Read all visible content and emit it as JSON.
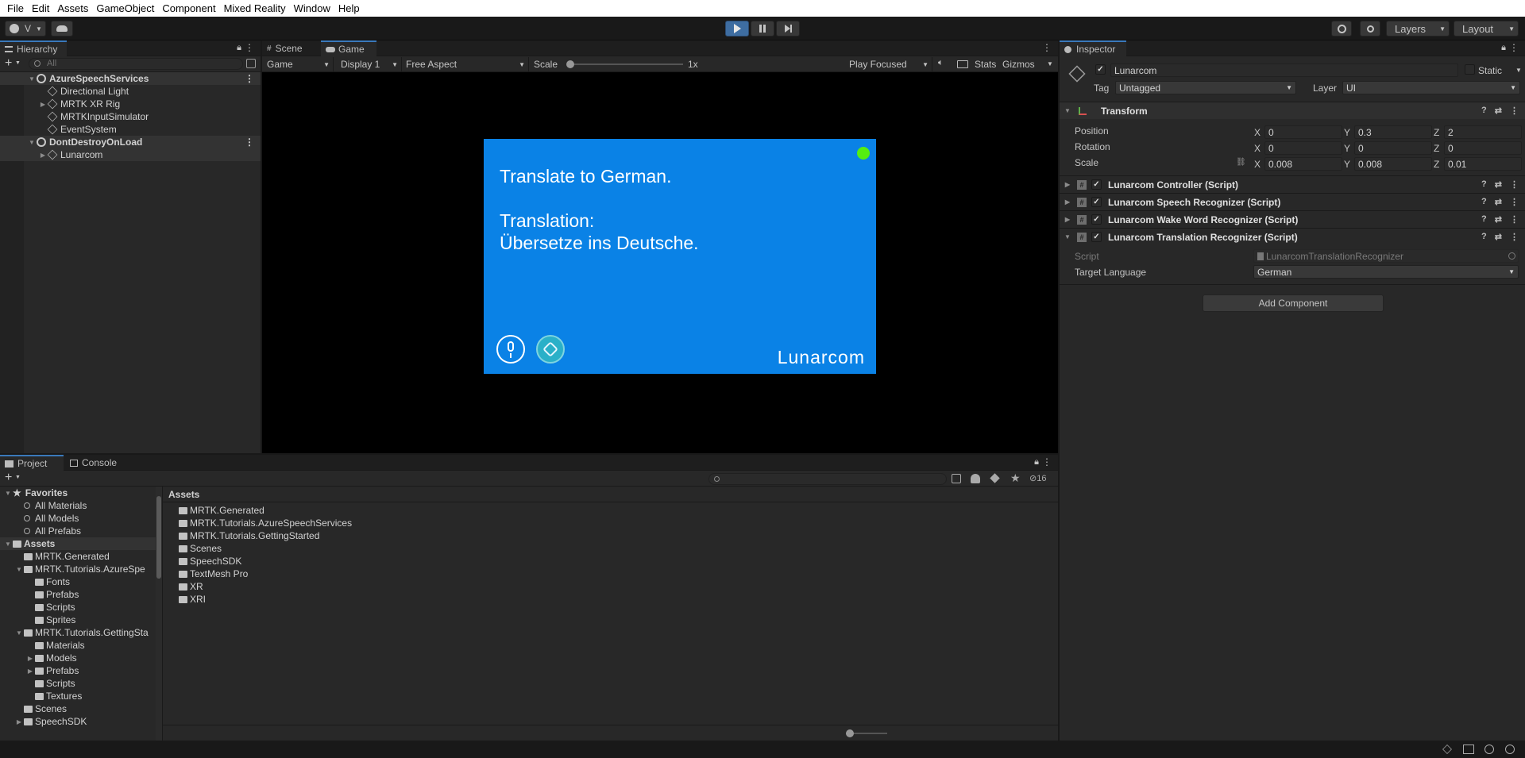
{
  "menu": [
    "File",
    "Edit",
    "Assets",
    "GameObject",
    "Component",
    "Mixed Reality",
    "Window",
    "Help"
  ],
  "toolbar": {
    "account_label": "V",
    "layers_label": "Layers",
    "layout_label": "Layout"
  },
  "hierarchy": {
    "tab": "Hierarchy",
    "search_placeholder": "All",
    "items": [
      {
        "label": "AzureSpeechServices",
        "scene": true
      },
      {
        "label": "Directional Light"
      },
      {
        "label": "MRTK XR Rig"
      },
      {
        "label": "MRTKInputSimulator"
      },
      {
        "label": "EventSystem"
      },
      {
        "label": "DontDestroyOnLoad",
        "scene": true
      },
      {
        "label": "Lunarcom"
      }
    ]
  },
  "game_view": {
    "tabs": [
      "Scene",
      "Game"
    ],
    "game_dropdown": "Game",
    "display": "Display 1",
    "aspect": "Free Aspect",
    "scale_label": "Scale",
    "scale_value": "1x",
    "play_focused": "Play Focused",
    "stats": "Stats",
    "gizmos": "Gizmos",
    "card": {
      "line1": "Translate to German.",
      "line2": "Translation:",
      "line3": "Übersetze ins Deutsche.",
      "brand": "Lunarcom",
      "bg_color": "#0a82e6",
      "status_color": "#55ee11"
    }
  },
  "inspector": {
    "tab": "Inspector",
    "object_name": "Lunarcom",
    "static_label": "Static",
    "tag_label": "Tag",
    "tag_value": "Untagged",
    "layer_label": "Layer",
    "layer_value": "UI",
    "transform": {
      "title": "Transform",
      "position_label": "Position",
      "rotation_label": "Rotation",
      "scale_label": "Scale",
      "position": {
        "x": "0",
        "y": "0.3",
        "z": "2"
      },
      "rotation": {
        "x": "0",
        "y": "0",
        "z": "0"
      },
      "scale": {
        "x": "0.008",
        "y": "0.008",
        "z": "0.01"
      }
    },
    "components": [
      "Lunarcom Controller (Script)",
      "Lunarcom Speech Recognizer (Script)",
      "Lunarcom Wake Word Recognizer (Script)",
      "Lunarcom Translation Recognizer (Script)"
    ],
    "script_label": "Script",
    "script_value": "LunarcomTranslationRecognizer",
    "target_language_label": "Target Language",
    "target_language_value": "German",
    "add_component": "Add Component"
  },
  "project": {
    "tabs": [
      "Project",
      "Console"
    ],
    "hidden_count": "16",
    "breadcrumb": "Assets",
    "tree": [
      {
        "label": "Favorites",
        "level": 0,
        "bold": true,
        "type": "star"
      },
      {
        "label": "All Materials",
        "level": 1,
        "type": "search"
      },
      {
        "label": "All Models",
        "level": 1,
        "type": "search"
      },
      {
        "label": "All Prefabs",
        "level": 1,
        "type": "search"
      },
      {
        "label": "Assets",
        "level": 0,
        "bold": true,
        "type": "folder"
      },
      {
        "label": "MRTK.Generated",
        "level": 1,
        "type": "folder"
      },
      {
        "label": "MRTK.Tutorials.AzureSpe",
        "level": 1,
        "type": "folder"
      },
      {
        "label": "Fonts",
        "level": 2,
        "type": "folder"
      },
      {
        "label": "Prefabs",
        "level": 2,
        "type": "folder"
      },
      {
        "label": "Scripts",
        "level": 2,
        "type": "folder"
      },
      {
        "label": "Sprites",
        "level": 2,
        "type": "folder"
      },
      {
        "label": "MRTK.Tutorials.GettingSta",
        "level": 1,
        "type": "folder"
      },
      {
        "label": "Materials",
        "level": 2,
        "type": "folder"
      },
      {
        "label": "Models",
        "level": 2,
        "type": "folder"
      },
      {
        "label": "Prefabs",
        "level": 2,
        "type": "folder"
      },
      {
        "label": "Scripts",
        "level": 2,
        "type": "folder"
      },
      {
        "label": "Textures",
        "level": 2,
        "type": "folder"
      },
      {
        "label": "Scenes",
        "level": 1,
        "type": "folder"
      },
      {
        "label": "SpeechSDK",
        "level": 1,
        "type": "folder"
      }
    ],
    "folders": [
      "MRTK.Generated",
      "MRTK.Tutorials.AzureSpeechServices",
      "MRTK.Tutorials.GettingStarted",
      "Scenes",
      "SpeechSDK",
      "TextMesh Pro",
      "XR",
      "XRI"
    ]
  }
}
